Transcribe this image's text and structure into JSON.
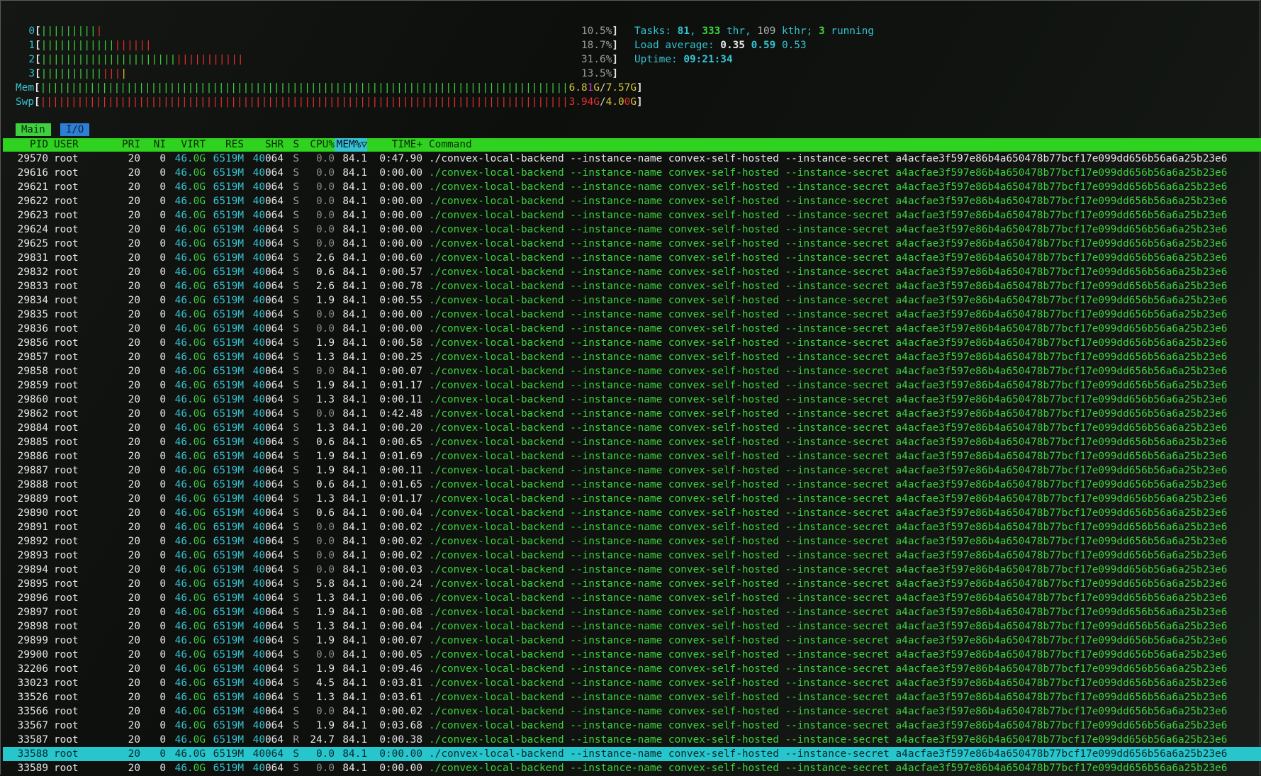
{
  "meters": {
    "cpus": [
      {
        "label": "0",
        "green": "|||||||||",
        "red": "|",
        "yellow": "",
        "pct": "10.5%"
      },
      {
        "label": "1",
        "green": "||||||||||||",
        "red": "||||||",
        "yellow": "",
        "pct": "18.7%"
      },
      {
        "label": "2",
        "green": "||||||||||||||||||||||",
        "red": "|||||||||||",
        "yellow": "",
        "pct": "31.6%"
      },
      {
        "label": "3",
        "green": "||||||||||",
        "red": "|||",
        "yellow": "|",
        "pct": "13.5%"
      }
    ],
    "mem": {
      "label": "Mem",
      "bar": "|||||||||||||||||||||||||||||||||||||||||||||||||||||||||||||||||||||||||||||||||||||||||||",
      "used_a": "6.8",
      "used_b": "1",
      "used_unit": "G",
      "total": "7.57G"
    },
    "swp": {
      "label": "Swp",
      "bar": "||||||||||||||||||||||||||||||||||||||||||||||||||||||||||||||||||||||||||||||||||||||||||||",
      "used": "3.94G",
      "total_a": "4.0",
      "total_b": "0",
      "total_unit": "G"
    }
  },
  "stats": {
    "tasks_label": "Tasks: ",
    "tasks": "81",
    "thr": "333",
    "thr_label": " thr, ",
    "kthr": "109",
    "kthr_label": " kthr; ",
    "running": "3",
    "running_label": " running",
    "load_label": "Load average: ",
    "load1": "0.35",
    "load5": "0.59",
    "load15": "0.53",
    "uptime_label": "Uptime: ",
    "uptime": "09:21:34"
  },
  "tabs": {
    "main": "Main",
    "io": "I/O"
  },
  "columns": {
    "pid": "PID",
    "user": "USER",
    "pri": "PRI",
    "ni": "NI",
    "virt": "VIRT",
    "res": "RES",
    "shr": "SHR",
    "s": "S",
    "cpu": "CPU%",
    "mem": "MEM%",
    "sort_arrow": "▽",
    "time": "TIME+",
    "command": "Command"
  },
  "cmd": {
    "exe": "./convex-local-backend",
    "flag1": "--instance-name",
    "val1": "convex-self-hosted",
    "flag2": "--instance-secret",
    "val2": "a4acfae3f597e86b4a650478b77bcf17e099dd656b56a6a25b23e6"
  },
  "common": {
    "user": "root",
    "pri": "20",
    "ni": "0",
    "virt_a": "46.",
    "virt_b": "0G",
    "res_a": "6519",
    "res_b": "M",
    "shr_a": "40",
    "shr_b": "064",
    "mem": "84.1"
  },
  "processes": [
    {
      "pid": "29570",
      "s": "S",
      "cpu": "0.0",
      "time": "0:47.90",
      "main": true
    },
    {
      "pid": "29616",
      "s": "S",
      "cpu": "0.0",
      "time": "0:00.00"
    },
    {
      "pid": "29621",
      "s": "S",
      "cpu": "0.0",
      "time": "0:00.00"
    },
    {
      "pid": "29622",
      "s": "S",
      "cpu": "0.0",
      "time": "0:00.00"
    },
    {
      "pid": "29623",
      "s": "S",
      "cpu": "0.0",
      "time": "0:00.00"
    },
    {
      "pid": "29624",
      "s": "S",
      "cpu": "0.0",
      "time": "0:00.00"
    },
    {
      "pid": "29625",
      "s": "S",
      "cpu": "0.0",
      "time": "0:00.00"
    },
    {
      "pid": "29831",
      "s": "S",
      "cpu": "2.6",
      "time": "0:00.60"
    },
    {
      "pid": "29832",
      "s": "S",
      "cpu": "0.6",
      "time": "0:00.57"
    },
    {
      "pid": "29833",
      "s": "S",
      "cpu": "2.6",
      "time": "0:00.78"
    },
    {
      "pid": "29834",
      "s": "S",
      "cpu": "1.9",
      "time": "0:00.55"
    },
    {
      "pid": "29835",
      "s": "S",
      "cpu": "0.0",
      "time": "0:00.00"
    },
    {
      "pid": "29836",
      "s": "S",
      "cpu": "0.0",
      "time": "0:00.00"
    },
    {
      "pid": "29856",
      "s": "S",
      "cpu": "1.9",
      "time": "0:00.58"
    },
    {
      "pid": "29857",
      "s": "S",
      "cpu": "1.3",
      "time": "0:00.25"
    },
    {
      "pid": "29858",
      "s": "S",
      "cpu": "0.0",
      "time": "0:00.07"
    },
    {
      "pid": "29859",
      "s": "S",
      "cpu": "1.9",
      "time": "0:01.17"
    },
    {
      "pid": "29860",
      "s": "S",
      "cpu": "1.3",
      "time": "0:00.11"
    },
    {
      "pid": "29862",
      "s": "S",
      "cpu": "0.0",
      "time": "0:42.48"
    },
    {
      "pid": "29884",
      "s": "S",
      "cpu": "1.3",
      "time": "0:00.20"
    },
    {
      "pid": "29885",
      "s": "S",
      "cpu": "0.6",
      "time": "0:00.65"
    },
    {
      "pid": "29886",
      "s": "S",
      "cpu": "1.9",
      "time": "0:01.69"
    },
    {
      "pid": "29887",
      "s": "S",
      "cpu": "1.9",
      "time": "0:00.11"
    },
    {
      "pid": "29888",
      "s": "S",
      "cpu": "0.6",
      "time": "0:01.65"
    },
    {
      "pid": "29889",
      "s": "S",
      "cpu": "1.3",
      "time": "0:01.17"
    },
    {
      "pid": "29890",
      "s": "S",
      "cpu": "0.6",
      "time": "0:00.04"
    },
    {
      "pid": "29891",
      "s": "S",
      "cpu": "0.0",
      "time": "0:00.02"
    },
    {
      "pid": "29892",
      "s": "S",
      "cpu": "0.0",
      "time": "0:00.02"
    },
    {
      "pid": "29893",
      "s": "S",
      "cpu": "0.0",
      "time": "0:00.02"
    },
    {
      "pid": "29894",
      "s": "S",
      "cpu": "0.0",
      "time": "0:00.03"
    },
    {
      "pid": "29895",
      "s": "S",
      "cpu": "5.8",
      "time": "0:00.24"
    },
    {
      "pid": "29896",
      "s": "S",
      "cpu": "1.3",
      "time": "0:00.06"
    },
    {
      "pid": "29897",
      "s": "S",
      "cpu": "1.9",
      "time": "0:00.08"
    },
    {
      "pid": "29898",
      "s": "S",
      "cpu": "1.3",
      "time": "0:00.04"
    },
    {
      "pid": "29899",
      "s": "S",
      "cpu": "1.9",
      "time": "0:00.07"
    },
    {
      "pid": "29900",
      "s": "S",
      "cpu": "0.0",
      "time": "0:00.05"
    },
    {
      "pid": "32206",
      "s": "S",
      "cpu": "1.9",
      "time": "0:09.46"
    },
    {
      "pid": "33023",
      "s": "S",
      "cpu": "4.5",
      "time": "0:03.81"
    },
    {
      "pid": "33526",
      "s": "S",
      "cpu": "1.3",
      "time": "0:03.61"
    },
    {
      "pid": "33566",
      "s": "S",
      "cpu": "0.0",
      "time": "0:00.02"
    },
    {
      "pid": "33567",
      "s": "S",
      "cpu": "1.9",
      "time": "0:03.68"
    },
    {
      "pid": "33587",
      "s": "R",
      "cpu": "24.7",
      "time": "0:00.38"
    },
    {
      "pid": "33588",
      "s": "S",
      "cpu": "0.0",
      "time": "0:00.00",
      "selected": true
    },
    {
      "pid": "33589",
      "s": "S",
      "cpu": "0.0",
      "time": "0:00.00"
    }
  ]
}
